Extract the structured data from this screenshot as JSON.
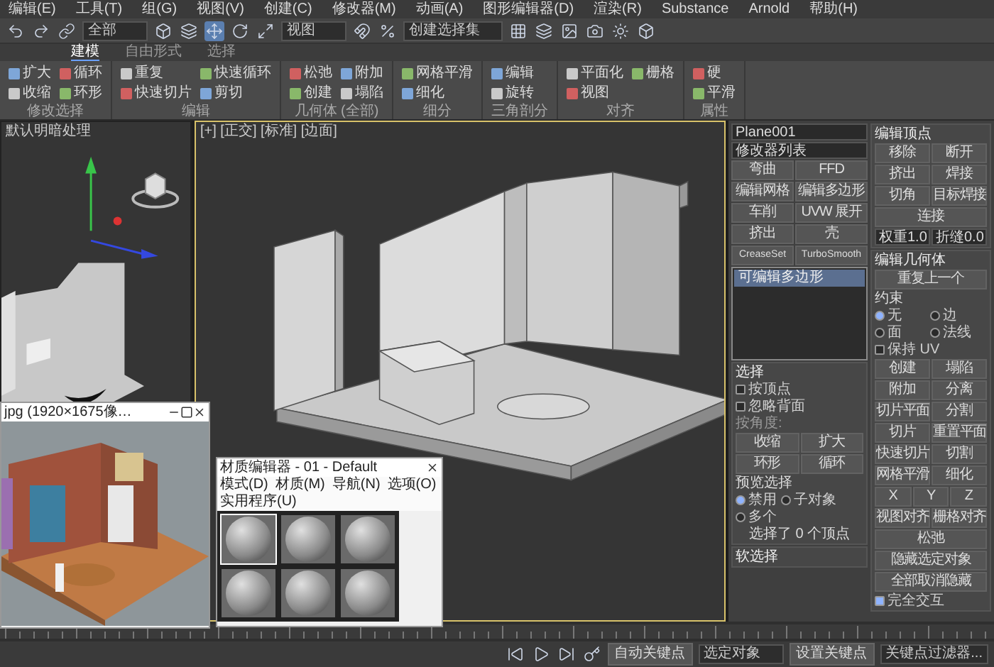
{
  "menu_bar": [
    "编辑(E)",
    "工具(T)",
    "组(G)",
    "视图(V)",
    "创建(C)",
    "修改器(M)",
    "动画(A)",
    "图形编辑器(D)",
    "渲染(R)",
    "Substance",
    "Arnold",
    "帮助(H)"
  ],
  "toolbar": {
    "filter": "全部",
    "coord": "视图",
    "selection_set": "创建选择集"
  },
  "ribbon": {
    "tabs": [
      {
        "label": "建模",
        "selected": true
      },
      {
        "label": "自由形式",
        "selected": false
      },
      {
        "label": "选择",
        "selected": false
      }
    ],
    "groups": [
      {
        "label": "修改选择",
        "buttons": [
          "扩大",
          "收缩",
          "循环",
          "环形"
        ]
      },
      {
        "label": "编辑",
        "buttons": [
          "重复",
          "快速切片",
          "快速循环",
          "剪切"
        ]
      },
      {
        "label": "几何体 (全部)",
        "buttons": [
          "松弛",
          "创建",
          "附加",
          "塌陷"
        ]
      },
      {
        "label": "细分",
        "buttons": [
          "网格平滑",
          "细化"
        ]
      },
      {
        "label": "三角剖分",
        "buttons": [
          "编辑",
          "旋转"
        ]
      },
      {
        "label": "对齐",
        "buttons": [
          "平面化",
          "视图",
          "栅格"
        ]
      },
      {
        "label": "属性",
        "buttons": [
          "硬",
          "平滑"
        ]
      }
    ]
  },
  "left_viewport": {
    "label": "默认明暗处理"
  },
  "main_viewport": {
    "label": "[+] [正交] [标准] [边面]"
  },
  "command_panel": {
    "object_name": "Plane001",
    "modifier_list": "修改器列表",
    "modifier_buttons": [
      "弯曲",
      "FFD",
      "编辑网格",
      "编辑多边形",
      "车削",
      "UVW 展开",
      "挤出",
      "壳",
      "CreaseSet",
      "TurboSmooth"
    ],
    "stack": [
      {
        "label": "可编辑多边形",
        "selected": true
      }
    ],
    "selection": {
      "title": "选择",
      "options": [
        {
          "label": "按顶点",
          "checked": false
        },
        {
          "label": "忽略背面",
          "checked": false
        }
      ],
      "angle_label": "按角度:",
      "buttons": [
        "收缩",
        "扩大",
        "环形",
        "循环"
      ],
      "preview_label": "预览选择",
      "preview_options": [
        {
          "label": "禁用",
          "selected": true
        },
        {
          "label": "子对象",
          "selected": false
        },
        {
          "label": "多个",
          "selected": false
        }
      ],
      "status": "选择了 0 个顶点"
    },
    "soft_selection": "软选择",
    "edit_vertices": {
      "title": "编辑顶点",
      "buttons": [
        "移除",
        "断开",
        "挤出",
        "焊接",
        "切角",
        "目标焊接",
        "连接"
      ],
      "fields": [
        {
          "label": "权重",
          "value": "1.0"
        },
        {
          "label": "折缝",
          "value": "0.0"
        }
      ]
    },
    "edit_geometry": {
      "title": "编辑几何体",
      "repeat": "重复上一个",
      "constraint_label": "约束",
      "constraints": [
        {
          "label": "无",
          "selected": true
        },
        {
          "label": "边",
          "selected": false
        },
        {
          "label": "面",
          "selected": false
        },
        {
          "label": "法线",
          "selected": false
        }
      ],
      "preserve_uv": {
        "label": "保持 UV",
        "checked": false
      },
      "buttons": [
        "创建",
        "塌陷",
        "附加",
        "分离",
        "切片平面",
        "分割",
        "切片",
        "重置平面",
        "快速切片",
        "切割",
        "网格平滑",
        "细化"
      ],
      "axes": [
        "X",
        "Y",
        "Z"
      ],
      "align_buttons": [
        "视图对齐",
        "栅格对齐"
      ],
      "relax": "松弛",
      "hide_buttons": [
        "隐藏选定对象",
        "全部取消隐藏"
      ],
      "full_interactivity": {
        "label": "完全交互",
        "checked": true
      }
    }
  },
  "image_viewer": {
    "title": "jpg (1920×1675像…"
  },
  "material_editor": {
    "title": "材质编辑器 - 01 - Default",
    "menus": [
      "模式(D)",
      "材质(M)",
      "导航(N)",
      "选项(O)",
      "实用程序(U)"
    ],
    "slots": [
      {
        "selected": true
      },
      {
        "selected": false
      },
      {
        "selected": false
      },
      {
        "selected": false
      },
      {
        "selected": false
      },
      {
        "selected": false
      }
    ]
  },
  "status_bar": {
    "buttons": [
      "自动关键点",
      "设置关键点"
    ],
    "dropdowns": [
      "选定对象",
      "关键点过滤器..."
    ]
  }
}
